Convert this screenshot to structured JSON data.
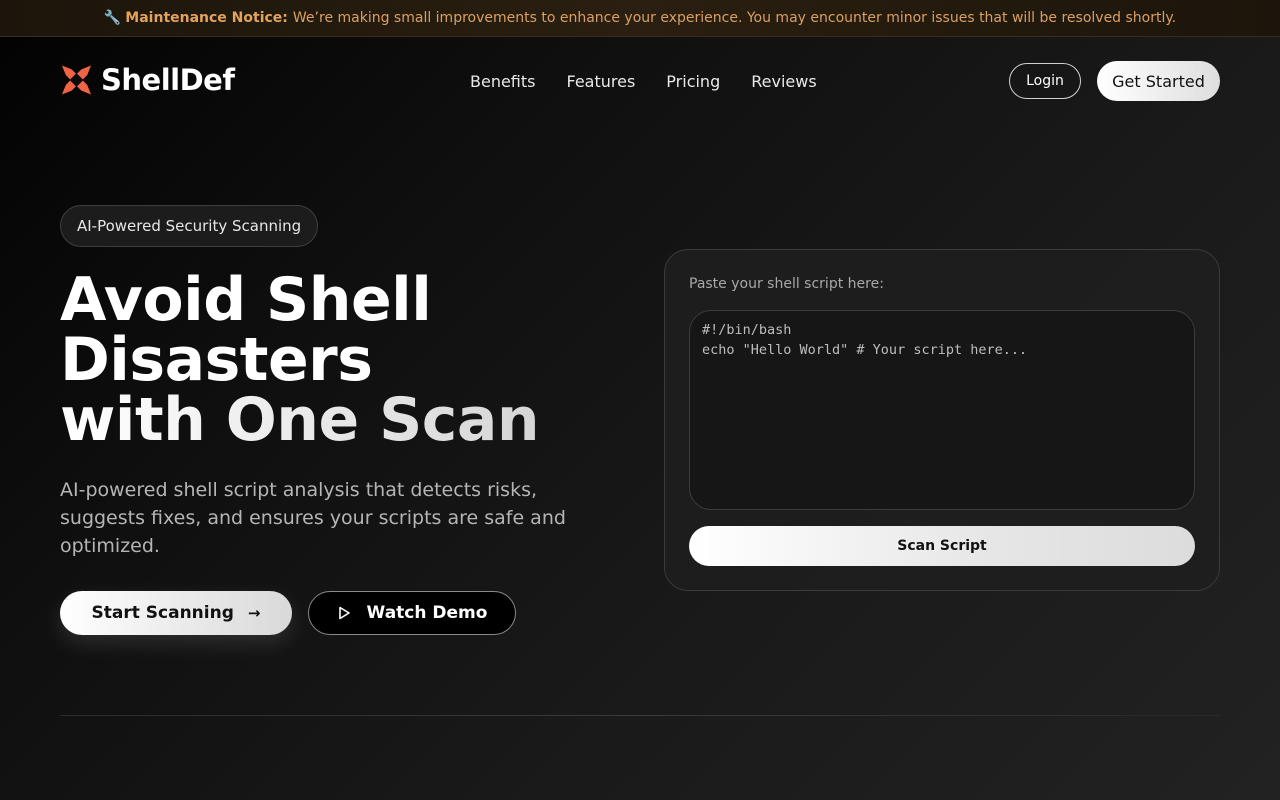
{
  "banner": {
    "icon": "wrench-icon",
    "label": "Maintenance Notice:",
    "message": "We’re making small improvements to enhance your experience. You may encounter minor issues that will be resolved shortly."
  },
  "header": {
    "logo_text": "ShellDef",
    "nav": [
      "Benefits",
      "Features",
      "Pricing",
      "Reviews"
    ],
    "login_label": "Login",
    "get_started_label": "Get Started"
  },
  "hero": {
    "badge": "AI-Powered Security Scanning",
    "title_lines": [
      "Avoid Shell",
      "Disasters",
      "with One Scan"
    ],
    "subtitle": "AI-powered shell script analysis that detects risks, suggests fixes, and ensures your scripts are safe and optimized.",
    "start_label": "Start Scanning",
    "demo_label": "Watch Demo"
  },
  "scanner": {
    "label": "Paste your shell script here:",
    "placeholder": "#!/bin/bash\necho \"Hello World\" # Your script here...",
    "button_label": "Scan Script"
  },
  "colors": {
    "brand_accent": "#f06445",
    "notice_text": "#e2a35a"
  }
}
